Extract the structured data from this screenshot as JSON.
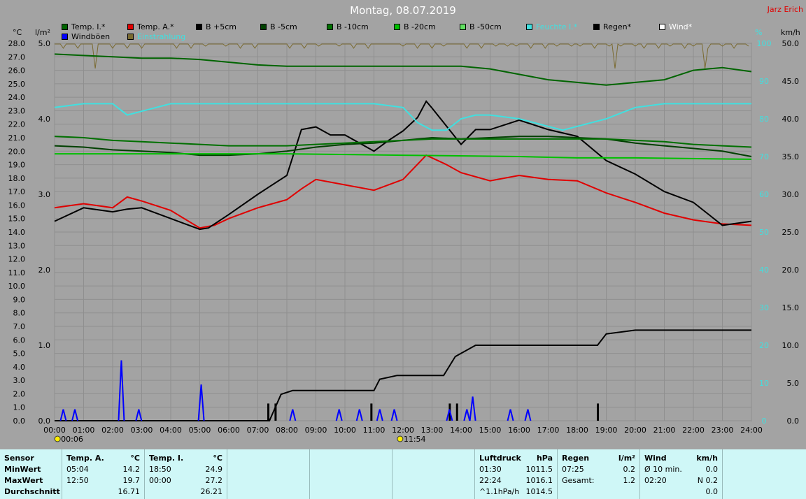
{
  "header": {
    "title": "Montag, 08.07.2019",
    "author": "Jarz Erich"
  },
  "legend": [
    {
      "label": "Temp. I.*",
      "color": "#006400"
    },
    {
      "label": "Temp. A.*",
      "color": "#e00000"
    },
    {
      "label": "B +5cm",
      "color": "#000000"
    },
    {
      "label": "B -5cm",
      "color": "#004000"
    },
    {
      "label": "B -10cm",
      "color": "#007000"
    },
    {
      "label": "B -20cm",
      "color": "#00c000"
    },
    {
      "label": "B -50cm",
      "color": "#60e060"
    },
    {
      "label": "Feuchte I.*",
      "color": "#40e0e0"
    },
    {
      "label": "Regen*",
      "color": "#000000"
    },
    {
      "label": "Wind*",
      "color": "#ffffff"
    },
    {
      "label": "Windböen",
      "color": "#0000ff"
    },
    {
      "label": "Einstrahlung",
      "color": "#7a6a30"
    }
  ],
  "chart_data": {
    "type": "line",
    "title": "Montag, 08.07.2019",
    "x_ticks": [
      "00:00",
      "01:00",
      "02:00",
      "03:00",
      "04:00",
      "05:00",
      "06:00",
      "07:00",
      "08:00",
      "09:00",
      "10:00",
      "11:00",
      "12:00",
      "13:00",
      "14:00",
      "15:00",
      "16:00",
      "17:00",
      "18:00",
      "19:00",
      "20:00",
      "21:00",
      "22:00",
      "23:00",
      "24:00"
    ],
    "axis_units": {
      "temp": "°C",
      "rain": "l/m²",
      "humidity": "%",
      "wind": "km/h"
    },
    "y_temp_ticks": [
      "0.0",
      "1.0",
      "2.0",
      "3.0",
      "4.0",
      "5.0",
      "6.0",
      "7.0",
      "8.0",
      "9.0",
      "10.0",
      "11.0",
      "12.0",
      "13.0",
      "14.0",
      "15.0",
      "16.0",
      "17.0",
      "18.0",
      "19.0",
      "20.0",
      "21.0",
      "22.0",
      "23.0",
      "24.0",
      "25.0",
      "26.0",
      "27.0",
      "28.0"
    ],
    "y_rain_ticks": [
      "0.0",
      "1.0",
      "2.0",
      "3.0",
      "4.0",
      "5.0"
    ],
    "y_hum_ticks": [
      "0",
      "10",
      "20",
      "30",
      "40",
      "50",
      "60",
      "70",
      "80",
      "90",
      "100"
    ],
    "y_wind_ticks": [
      "0.0",
      "5.0",
      "10.0",
      "15.0",
      "20.0",
      "25.0",
      "30.0",
      "35.0",
      "40.0",
      "45.0",
      "50.0"
    ],
    "temp_range": [
      0,
      28
    ],
    "grid": true,
    "sun_markers": [
      {
        "label": "00:06"
      },
      {
        "label": "11:54"
      }
    ],
    "series": [
      {
        "name": "Temp. I.*",
        "color": "#006400",
        "axis": "temp",
        "x": [
          0,
          1,
          2,
          3,
          4,
          5,
          6,
          7,
          8,
          9,
          10,
          11,
          12,
          13,
          14,
          15,
          16,
          17,
          18,
          19,
          20,
          21,
          22,
          23,
          24
        ],
        "y": [
          27.2,
          27.1,
          27.0,
          26.9,
          26.9,
          26.8,
          26.6,
          26.4,
          26.3,
          26.3,
          26.3,
          26.3,
          26.3,
          26.3,
          26.3,
          26.1,
          25.7,
          25.3,
          25.1,
          24.9,
          25.1,
          25.3,
          26.0,
          26.2,
          25.9
        ]
      },
      {
        "name": "Temp. A.*",
        "color": "#e00000",
        "axis": "temp",
        "x": [
          0,
          1,
          2,
          2.5,
          3,
          4,
          5,
          5.5,
          6,
          7,
          8,
          8.5,
          9,
          10,
          11,
          12,
          12.8,
          13.5,
          14,
          15,
          16,
          17,
          18,
          19,
          20,
          21,
          22,
          23,
          24
        ],
        "y": [
          15.8,
          16.1,
          15.8,
          16.6,
          16.3,
          15.6,
          14.3,
          14.5,
          15.0,
          15.8,
          16.4,
          17.2,
          17.9,
          17.5,
          17.1,
          17.9,
          19.7,
          19.0,
          18.4,
          17.8,
          18.2,
          17.9,
          17.8,
          16.9,
          16.2,
          15.4,
          14.9,
          14.6,
          14.5
        ]
      },
      {
        "name": "B +5cm",
        "color": "#000000",
        "axis": "temp",
        "x": [
          0,
          1,
          2,
          2.5,
          3,
          4,
          4.5,
          5,
          5.3,
          6,
          7,
          8,
          8.5,
          9,
          9.5,
          10,
          11,
          11.5,
          12,
          12.5,
          12.8,
          13,
          14,
          14.5,
          15,
          16,
          17,
          18,
          19,
          20,
          21,
          22,
          23,
          24
        ],
        "y": [
          14.8,
          15.8,
          15.5,
          15.7,
          15.8,
          15.0,
          14.6,
          14.2,
          14.3,
          15.3,
          16.8,
          18.2,
          21.6,
          21.8,
          21.2,
          21.2,
          20.0,
          20.8,
          21.5,
          22.5,
          23.7,
          23.2,
          20.5,
          21.6,
          21.6,
          22.3,
          21.6,
          21.1,
          19.3,
          18.3,
          17.0,
          16.2,
          14.5,
          14.8
        ]
      },
      {
        "name": "B -5cm",
        "color": "#004000",
        "axis": "temp",
        "x": [
          0,
          1,
          2,
          3,
          4,
          5,
          6,
          7,
          8,
          9,
          10,
          11,
          12,
          13,
          14,
          15,
          16,
          17,
          18,
          19,
          20,
          21,
          22,
          23,
          24
        ],
        "y": [
          20.4,
          20.3,
          20.1,
          20.0,
          19.9,
          19.7,
          19.7,
          19.8,
          20.0,
          20.3,
          20.5,
          20.6,
          20.8,
          21.0,
          20.9,
          21.0,
          21.1,
          21.1,
          21.0,
          20.9,
          20.6,
          20.4,
          20.2,
          20.0,
          19.6
        ]
      },
      {
        "name": "B -10cm",
        "color": "#007000",
        "axis": "temp",
        "x": [
          0,
          1,
          2,
          3,
          4,
          5,
          6,
          7,
          8,
          9,
          10,
          11,
          12,
          13,
          14,
          15,
          16,
          17,
          18,
          19,
          20,
          21,
          22,
          23,
          24
        ],
        "y": [
          21.1,
          21.0,
          20.8,
          20.7,
          20.6,
          20.5,
          20.4,
          20.4,
          20.4,
          20.5,
          20.6,
          20.7,
          20.8,
          20.9,
          20.9,
          20.9,
          20.9,
          20.9,
          20.9,
          20.9,
          20.8,
          20.7,
          20.5,
          20.4,
          20.3
        ]
      },
      {
        "name": "B -20cm",
        "color": "#00c000",
        "axis": "temp",
        "x": [
          0,
          4,
          8,
          12,
          16,
          18,
          20,
          24
        ],
        "y": [
          19.8,
          19.8,
          19.8,
          19.7,
          19.6,
          19.5,
          19.5,
          19.4
        ]
      },
      {
        "name": "Feuchte I.*",
        "color": "#40e0e0",
        "axis": "humidity",
        "x": [
          0,
          1,
          2,
          2.5,
          3,
          4,
          5,
          6,
          7,
          8,
          9,
          10,
          11,
          12,
          12.5,
          13,
          13.5,
          14,
          14.5,
          15,
          16,
          17,
          17.5,
          18,
          19,
          20,
          21,
          22,
          23,
          24
        ],
        "y": [
          83,
          84,
          84,
          81,
          82,
          84,
          84,
          84,
          84,
          84,
          84,
          84,
          84,
          83,
          79,
          77,
          77,
          80,
          81,
          81,
          80,
          78,
          77,
          78,
          80,
          83,
          84,
          84,
          84,
          84
        ]
      },
      {
        "name": "Regen*",
        "color": "#000000",
        "axis": "rain",
        "x": [
          0,
          7.4,
          7.8,
          8.2,
          9,
          10,
          11,
          11.2,
          11.8,
          12,
          13,
          13.4,
          13.8,
          14.5,
          15,
          16,
          17,
          18,
          18.7,
          19,
          20,
          21,
          22,
          23,
          24
        ],
        "y": [
          0,
          0,
          0.35,
          0.4,
          0.4,
          0.4,
          0.4,
          0.55,
          0.6,
          0.6,
          0.6,
          0.6,
          0.85,
          1.0,
          1.0,
          1.0,
          1.0,
          1.0,
          1.0,
          1.15,
          1.2,
          1.2,
          1.2,
          1.2,
          1.2
        ]
      }
    ],
    "windboeen_bars": [
      {
        "x": 0.3,
        "v": 1.5
      },
      {
        "x": 0.7,
        "v": 1.5
      },
      {
        "x": 2.3,
        "v": 8.0
      },
      {
        "x": 2.9,
        "v": 1.5
      },
      {
        "x": 5.05,
        "v": 4.8
      },
      {
        "x": 8.2,
        "v": 1.5
      },
      {
        "x": 9.8,
        "v": 1.5
      },
      {
        "x": 10.5,
        "v": 1.5
      },
      {
        "x": 11.2,
        "v": 1.5
      },
      {
        "x": 11.7,
        "v": 1.5
      },
      {
        "x": 13.6,
        "v": 1.5
      },
      {
        "x": 14.2,
        "v": 1.5
      },
      {
        "x": 14.4,
        "v": 3.2
      },
      {
        "x": 15.7,
        "v": 1.5
      },
      {
        "x": 16.3,
        "v": 1.5
      }
    ],
    "rain_bars": [
      {
        "x": 7.35,
        "v": 0.2
      },
      {
        "x": 7.6,
        "v": 0.2
      },
      {
        "x": 10.9,
        "v": 0.2
      },
      {
        "x": 13.6,
        "v": 0.2
      },
      {
        "x": 13.85,
        "v": 0.2
      },
      {
        "x": 18.7,
        "v": 0.2
      }
    ],
    "einstrahlung_top": true
  },
  "footer": {
    "sensor_header": "Sensor",
    "row_labels": [
      "MinWert",
      "MaxWert",
      "Durchschnitt"
    ],
    "temp_a": {
      "title": "Temp. A.",
      "unit": "°C",
      "rows": [
        [
          "05:04",
          "14.2"
        ],
        [
          "12:50",
          "19.7"
        ],
        [
          "",
          "16.71"
        ]
      ]
    },
    "temp_i": {
      "title": "Temp. I.",
      "unit": "°C",
      "rows": [
        [
          "18:50",
          "24.9"
        ],
        [
          "00:00",
          "27.2"
        ],
        [
          "",
          "26.21"
        ]
      ]
    },
    "luftdruck": {
      "title": "Luftdruck",
      "unit": "hPa",
      "rows": [
        [
          "01:30",
          "1011.5"
        ],
        [
          "22:24",
          "1016.1"
        ],
        [
          "^1.1hPa/h",
          "1014.5"
        ]
      ]
    },
    "regen": {
      "title": "Regen",
      "unit": "l/m²",
      "rows": [
        [
          "",
          ""
        ],
        [
          "07:25",
          "0.2"
        ],
        [
          "Gesamt:",
          "1.2"
        ]
      ]
    },
    "wind": {
      "title": "Wind",
      "unit": "km/h",
      "rows": [
        [
          "Ø 10 min.",
          "0.0"
        ],
        [
          "02:20",
          "N 0.2"
        ],
        [
          "",
          "0.0"
        ]
      ]
    }
  }
}
